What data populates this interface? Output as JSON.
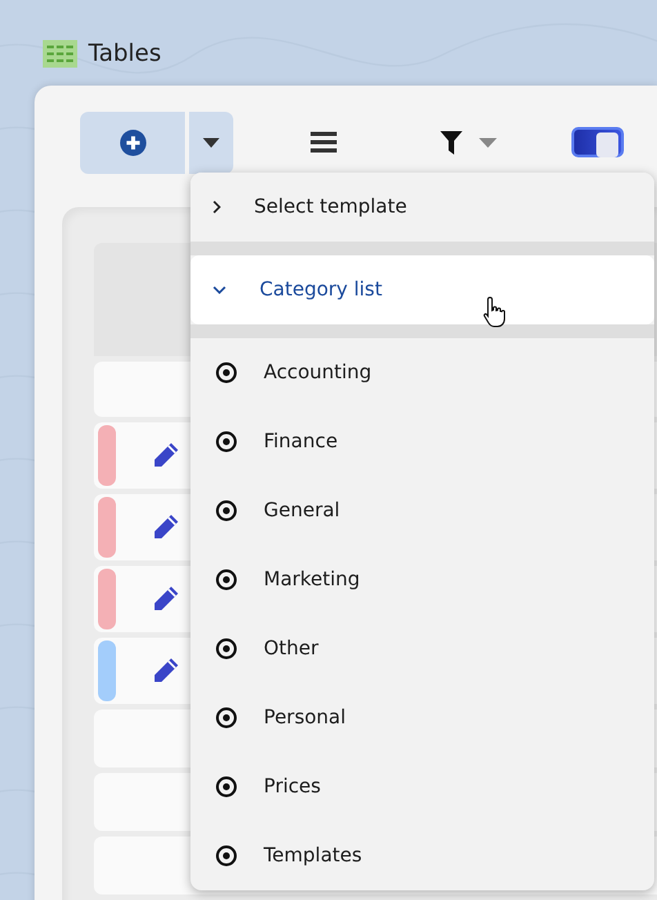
{
  "window": {
    "title": "Tables"
  },
  "toolbar": {
    "view_toggle": {
      "on": true
    }
  },
  "table": {
    "rows": [
      {
        "color": "#f4b0b5"
      },
      {
        "color": "#f4b0b5"
      },
      {
        "color": "#f4b0b5"
      },
      {
        "color": "#a3cdfb"
      }
    ]
  },
  "menu": {
    "sections": [
      {
        "label": "Select template",
        "expanded": false
      },
      {
        "label": "Category list",
        "expanded": true
      }
    ],
    "items": [
      {
        "label": "Accounting"
      },
      {
        "label": "Finance"
      },
      {
        "label": "General"
      },
      {
        "label": "Marketing"
      },
      {
        "label": "Other"
      },
      {
        "label": "Personal"
      },
      {
        "label": "Prices"
      },
      {
        "label": "Templates"
      }
    ]
  }
}
